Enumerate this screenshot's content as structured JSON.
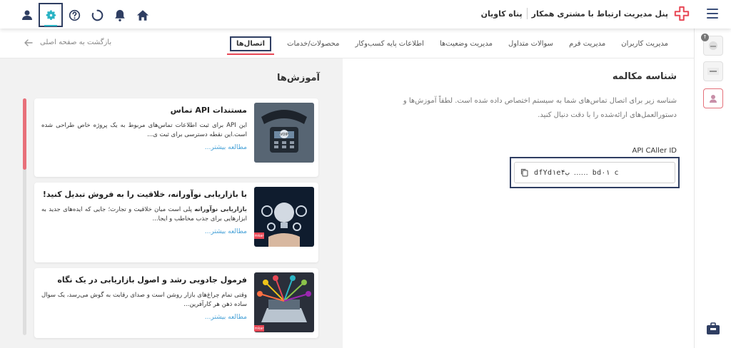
{
  "header": {
    "title": "پنل مدیریت ارتباط با مشتری همکار",
    "subtitle": "پناه کاویان"
  },
  "top_icons": [
    "user-icon",
    "settings-icon",
    "help-icon",
    "loading-icon",
    "bell-icon",
    "home-icon"
  ],
  "tabs": [
    {
      "label": "مدیریت کاربران"
    },
    {
      "label": "مدیریت فرم"
    },
    {
      "label": "سوالات متداول"
    },
    {
      "label": "مدیریت وضعیت‌ها"
    },
    {
      "label": "اطلاعات پایه کسب‌وکار"
    },
    {
      "label": "محصولات/خدمات"
    },
    {
      "label": "اتصال‌ها",
      "active": true
    }
  ],
  "back_label": "بازگشت به صفحه اصلی",
  "tutorials": {
    "title": "آموزش‌ها",
    "progress": 0.3,
    "cards": [
      {
        "title": "مستندات API تماس",
        "desc": "این API برای ثبت اطلاعات تماس‌های مربوط به یک پروژه خاص طراحی شده است.این نقطه دسترسی برای ثبت ی...",
        "more": "مطالعه بیشتر...",
        "image": "voip-phone"
      },
      {
        "title": "با بازاریابی نوآورانه، خلاقیت را به فروش تبدیل کنید!",
        "desc_bold": "بازاریابی نوآورانه",
        "desc": " پلی است میان خلاقیت و تجارت؛ جایی که ایده‌های جدید به ابزارهایی برای جذب مخاطب و ایجا...",
        "more": "مطالعه بیشتر...",
        "image": "lightbulb-gears"
      },
      {
        "title": "فرمول جادویی رشد و اصول بازاریابی در یک نگاه",
        "desc": "وقتی تمام چراغ‌های بازار روشن است و صدای رقابت به گوش می‌رسد، یک سوال ساده ذهن هر کارآفرین...",
        "more": "مطالعه بیشتر...",
        "image": "marketing-network"
      }
    ]
  },
  "caller": {
    "title": "شناسه مکالمه",
    "desc": "شناسه زیر برای اتصال تماس‌های شما به سیستم اختصاص داده شده است. لطفاً آموزش‌ها و دستورالعمل‌های ارائه‌شده را با دقت دنبال کنید.",
    "label": "API CAller ID",
    "value": "dfYd١e۴ب ‥‥‥ bd٠١‌‌‌‌‌ c"
  },
  "colors": {
    "accent": "#2f3e62",
    "brand": "#e84856",
    "link": "#4aa3d8",
    "teal": "#2ab3c4"
  }
}
